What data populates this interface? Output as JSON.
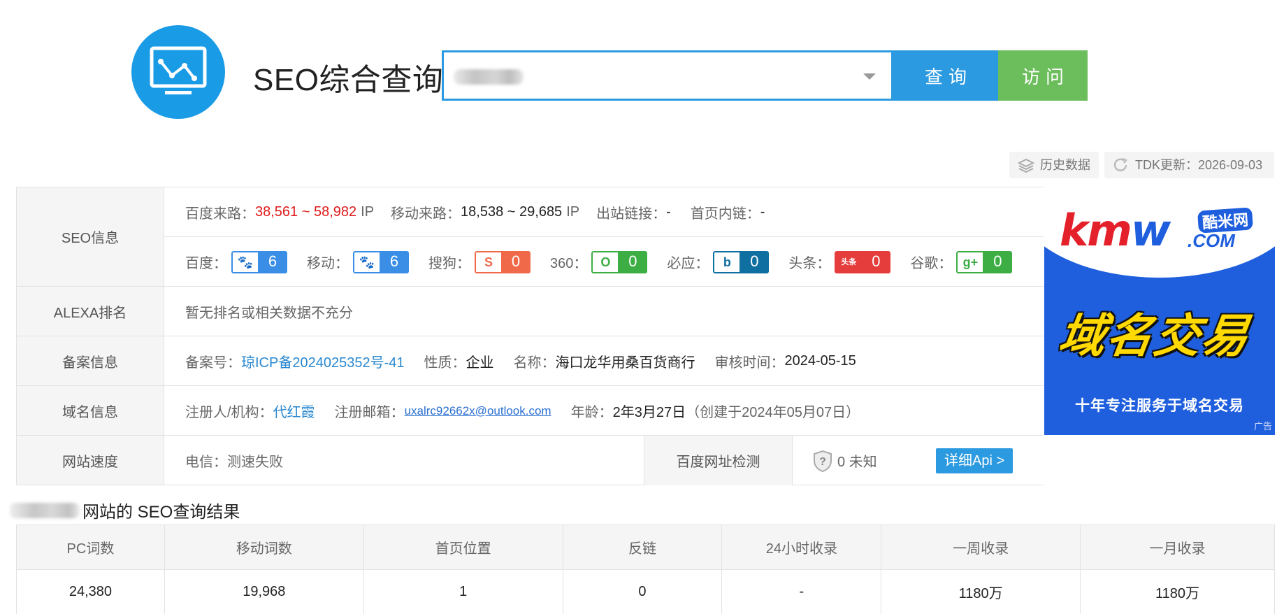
{
  "header": {
    "logo_icon": "monitor-chart-icon",
    "title": "SEO综合查询",
    "search_value": "",
    "query_button": "查询",
    "visit_button": "访问",
    "colors": {
      "primary": "#2c9ae0",
      "visit": "#6cbd5c"
    }
  },
  "toolbar": {
    "history": "历史数据",
    "tdk": "TDK更新：2026-09-03"
  },
  "seo": {
    "label": "SEO信息",
    "baidu_traffic_label": "百度来路：",
    "baidu_traffic_value": "38,561 ~ 58,982",
    "ip1": "IP",
    "mobile_traffic_label": "移动来路：",
    "mobile_traffic_value": "18,538 ~ 29,685",
    "ip2": "IP",
    "outlinks_label": "出站链接：",
    "outlinks_value": "-",
    "inlinks_label": "首页内链：",
    "inlinks_value": "-",
    "weights": [
      {
        "label": "百度：",
        "value": "6",
        "icon": "baidu-paw-icon",
        "color": "#3a8ee6"
      },
      {
        "label": "移动：",
        "value": "6",
        "icon": "baidu-paw-icon",
        "color": "#3a8ee6"
      },
      {
        "label": "搜狗：",
        "value": "0",
        "icon": "sogou-icon",
        "color": "#f06a4a"
      },
      {
        "label": "360：",
        "value": "0",
        "icon": "so360-icon",
        "color": "#3dae44"
      },
      {
        "label": "必应：",
        "value": "0",
        "icon": "bing-icon",
        "color": "#0f6fa0"
      },
      {
        "label": "头条：",
        "value": "0",
        "icon": "toutiao-icon",
        "color": "#e53c3c"
      },
      {
        "label": "谷歌：",
        "value": "0",
        "icon": "google-plus-icon",
        "color": "#3dae44"
      }
    ]
  },
  "alexa": {
    "label": "ALEXA排名",
    "value": "暂无排名或相关数据不充分"
  },
  "icp": {
    "label": "备案信息",
    "no_label": "备案号：",
    "no_value": "琼ICP备2024025352号-41",
    "nature_label": "性质：",
    "nature_value": "企业",
    "name_label": "名称：",
    "name_value": "海口龙华用桑百货商行",
    "time_label": "审核时间：",
    "time_value": "2024-05-15"
  },
  "domain": {
    "label": "域名信息",
    "registrant_label": "注册人/机构：",
    "registrant_value": "代红霞",
    "email_label": "注册邮箱：",
    "email_value": "uxalrc92662x@outlook.com",
    "age_label": "年龄：",
    "age_value": "2年3月27日",
    "created": "（创建于2024年05月07日）"
  },
  "speed": {
    "label": "网站速度",
    "value": "电信：测速失败",
    "check_label": "百度网址检测",
    "unknown": "0 未知",
    "api_button": "详细Api >"
  },
  "ad": {
    "brand": "kmw",
    "cn_brand": "酷米网",
    "com": ".COM",
    "headline": "域名交易",
    "slogan": "十年专注服务于域名交易",
    "tag": "广告"
  },
  "results": {
    "title": "网站的 SEO查询结果",
    "headers": [
      "PC词数",
      "移动词数",
      "首页位置",
      "反链",
      "24小时收录",
      "一周收录",
      "一月收录"
    ],
    "row": [
      "24,380",
      "19,968",
      "1",
      "0",
      "-",
      "1180万",
      "1180万"
    ]
  }
}
